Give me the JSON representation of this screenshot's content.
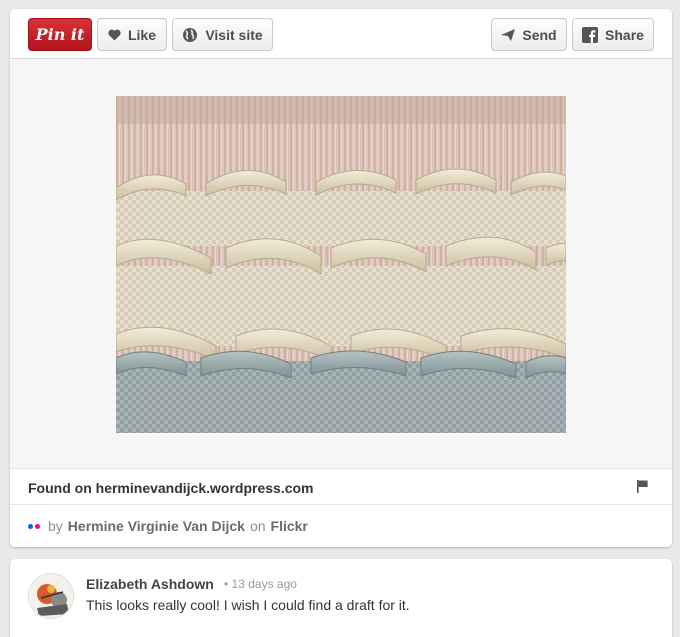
{
  "toolbar": {
    "pinit_label": "Pin it",
    "like_label": "Like",
    "visit_label": "Visit site",
    "send_label": "Send",
    "share_label": "Share"
  },
  "pin": {
    "image_alt": "Woven textile on a loom with cream rope-like wefts and a grey-blue band",
    "found_on": "Found on herminevandijck.wordpress.com",
    "credit_by": "by",
    "credit_name": "Hermine Virginie Van Dijck",
    "credit_on": "on",
    "credit_site": "Flickr"
  },
  "comment": {
    "author": "Elizabeth Ashdown",
    "time": "• 13 days ago",
    "text": "This looks really cool! I wish I could find a draft for it."
  },
  "colors": {
    "pinit_red": "#cb2027",
    "flickr_blue": "#0063dc",
    "flickr_pink": "#ff0084"
  }
}
